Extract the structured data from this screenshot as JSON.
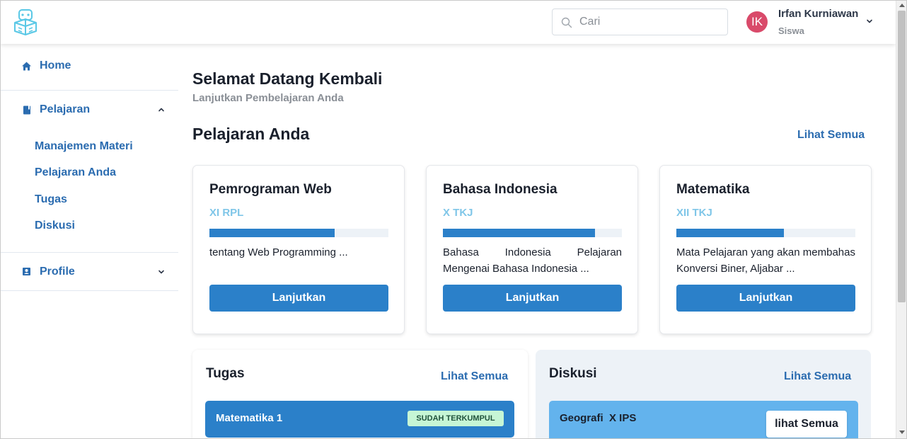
{
  "header": {
    "logo_icon": "robot-book-icon",
    "search": {
      "placeholder": "Cari",
      "value": ""
    },
    "user": {
      "initials": "IK",
      "name": "Irfan Kurniawan",
      "role": "Siswa",
      "avatar_color": "#d94a6a"
    }
  },
  "sidebar": {
    "home": {
      "label": "Home",
      "icon": "home-icon"
    },
    "pelajaran": {
      "label": "Pelajaran",
      "icon": "book-icon",
      "expanded": true,
      "items": [
        {
          "label": "Manajemen Materi"
        },
        {
          "label": "Pelajaran Anda"
        },
        {
          "label": "Tugas"
        },
        {
          "label": "Diskusi"
        }
      ]
    },
    "profile": {
      "label": "Profile",
      "icon": "id-card-icon",
      "expanded": false
    }
  },
  "main": {
    "welcome_title": "Selamat Datang Kembali",
    "welcome_subtitle": "Lanjutkan Pembelajaran Anda",
    "courses_title": "Pelajaran Anda",
    "courses_see_all": "Lihat Semua",
    "courses": [
      {
        "title": "Pemrograman Web",
        "class": "XI RPL",
        "progress": 0.7,
        "description": "tentang Web Programming ...",
        "button": "Lanjutkan"
      },
      {
        "title": "Bahasa Indonesia",
        "class": "X TKJ",
        "progress": 0.85,
        "description": "Bahasa Indonesia Pelajaran Mengenai Bahasa Indonesia ...",
        "button": "Lanjutkan"
      },
      {
        "title": "Matematika",
        "class": "XII TKJ",
        "progress": 0.6,
        "description": "Mata Pelajaran yang akan membahas Konversi Biner, Aljabar ...",
        "button": "Lanjutkan"
      }
    ],
    "tasks": {
      "title": "Tugas",
      "see_all": "Lihat Semua",
      "items": [
        {
          "name": "Matematika 1",
          "status": "SUDAH TERKUMPUL"
        }
      ]
    },
    "discussions": {
      "title": "Diskusi",
      "see_all": "Lihat Semua",
      "items": [
        {
          "name": "Geografi  X IPS",
          "button": "lihat Semua"
        }
      ]
    }
  },
  "colors": {
    "primary": "#2b80c9",
    "link": "#2b6cb0",
    "class_tag": "#7fc6e8",
    "badge_bg": "#c6f6d5",
    "discussion_row": "#63b3ed"
  }
}
